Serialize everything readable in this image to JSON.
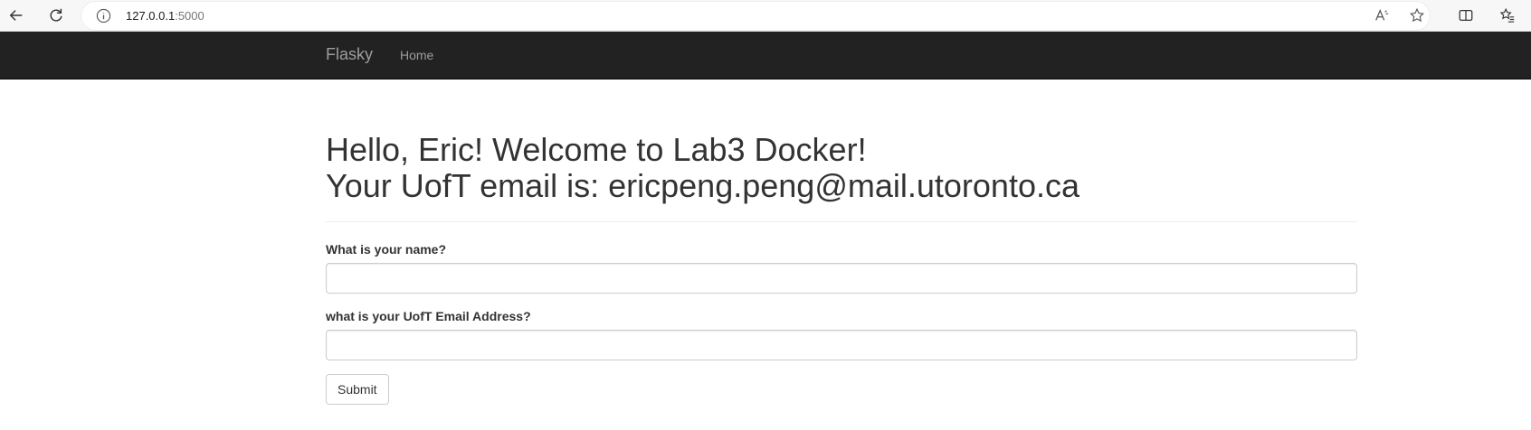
{
  "browser": {
    "url_host": "127.0.0.1",
    "url_port": ":5000"
  },
  "navbar": {
    "brand": "Flasky",
    "links": [
      {
        "label": "Home"
      }
    ]
  },
  "page": {
    "greeting": "Hello, Eric! Welcome to Lab3 Docker!",
    "email_line": "Your UofT email is: ericpeng.peng@mail.utoronto.ca"
  },
  "form": {
    "name_label": "What is your name?",
    "name_value": "",
    "email_label": "what is your UofT Email Address?",
    "email_value": "",
    "submit_label": "Submit"
  }
}
